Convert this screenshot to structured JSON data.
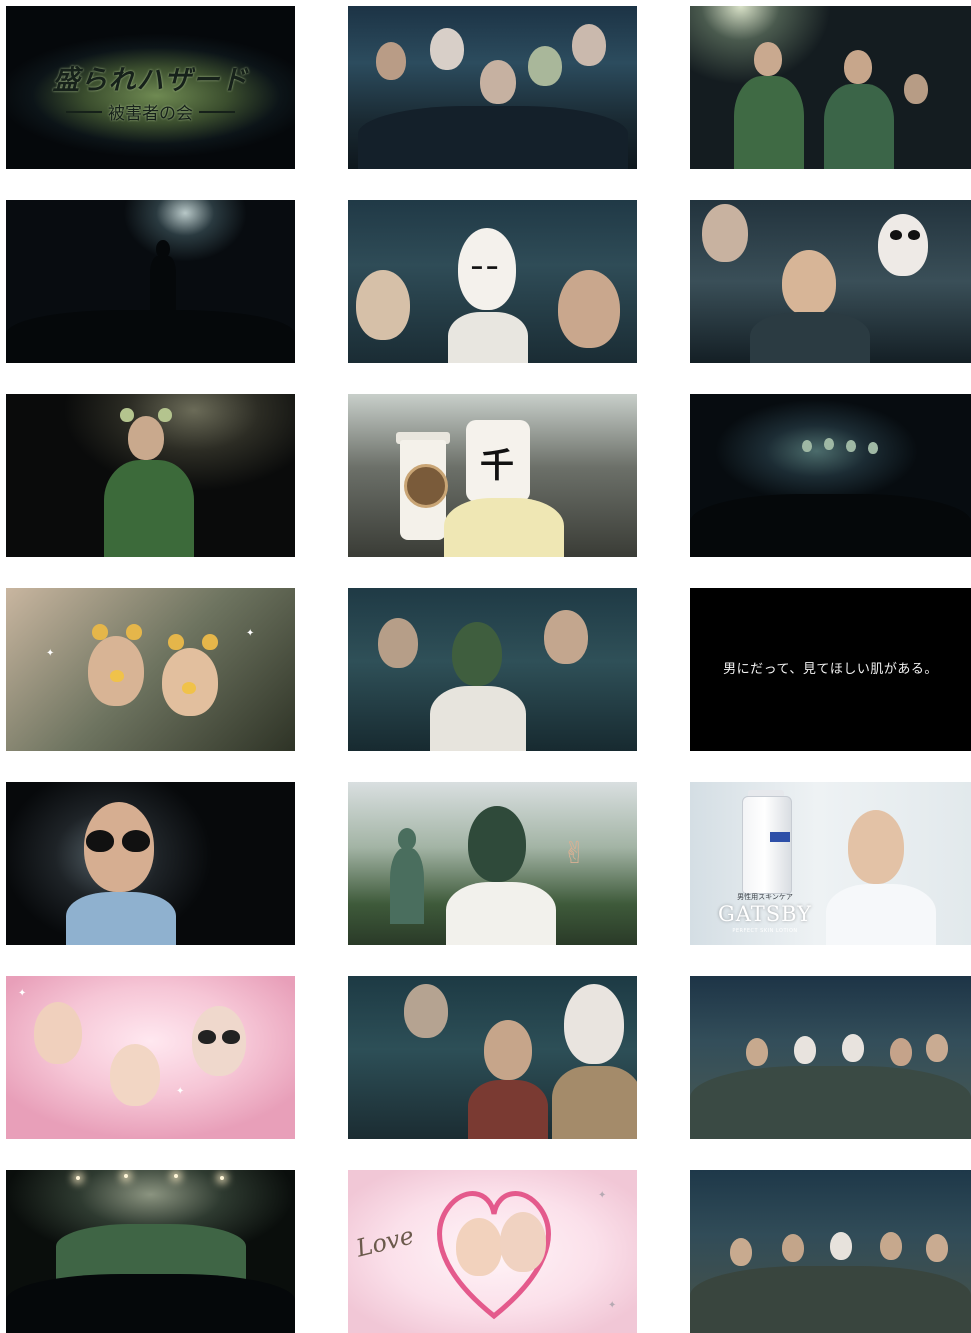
{
  "gallery": {
    "frames": [
      {
        "id": 1,
        "scene": "title-card",
        "text_main": "盛られハザード",
        "text_sub": "被害者の会"
      },
      {
        "id": 2,
        "scene": "crowd-masks"
      },
      {
        "id": 3,
        "scene": "stage-singers"
      },
      {
        "id": 4,
        "scene": "dark-stage"
      },
      {
        "id": 5,
        "scene": "crowd-drawn-face"
      },
      {
        "id": 6,
        "scene": "crowd-cheering"
      },
      {
        "id": 7,
        "scene": "singer-bear-ears"
      },
      {
        "id": 8,
        "scene": "cafe-coffee-cup"
      },
      {
        "id": 9,
        "scene": "band-stage"
      },
      {
        "id": 10,
        "scene": "couple-selfie-filter"
      },
      {
        "id": 11,
        "scene": "crowd-green-face"
      },
      {
        "id": 12,
        "scene": "tagline",
        "text": "男にだって、見てほしい肌がある。"
      },
      {
        "id": 13,
        "scene": "man-glasses-filter"
      },
      {
        "id": 14,
        "scene": "park-statue"
      },
      {
        "id": 15,
        "scene": "gatsby-product",
        "label_small": "男性用スキンケア",
        "brand": "GATSBY",
        "product": "PERFECT SKIN LOTION"
      },
      {
        "id": 16,
        "scene": "photo-sticker-family"
      },
      {
        "id": 17,
        "scene": "crowd-closeup"
      },
      {
        "id": 18,
        "scene": "group-photo"
      },
      {
        "id": 19,
        "scene": "band-stage-lights"
      },
      {
        "id": 20,
        "scene": "love-heart-photo",
        "text": "Love"
      },
      {
        "id": 21,
        "scene": "group-photo-wide"
      }
    ]
  },
  "colors": {
    "background": "#ffffff",
    "tagline_text": "#f2f2f2",
    "gatsby_blue": "#2d4fa8"
  }
}
